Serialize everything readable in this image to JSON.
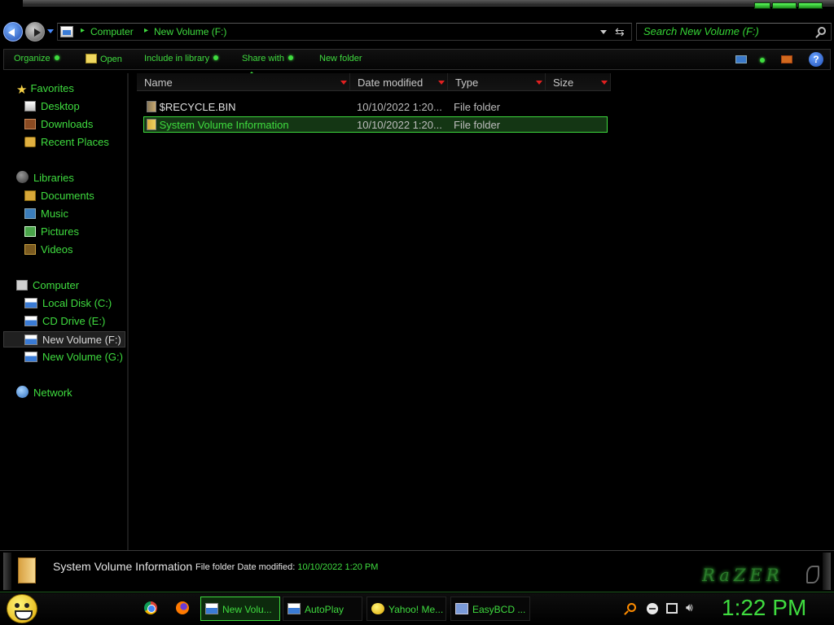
{
  "window": {
    "address": {
      "crumbs": [
        "Computer",
        "New Volume (F:)"
      ]
    },
    "search": {
      "placeholder": "Search New Volume (F:)"
    }
  },
  "toolbar": {
    "organize": "Organize",
    "open": "Open",
    "include_in_library": "Include in library",
    "share_with": "Share with",
    "new_folder": "New folder"
  },
  "nav": {
    "favorites": {
      "label": "Favorites",
      "items": [
        "Desktop",
        "Downloads",
        "Recent Places"
      ]
    },
    "libraries": {
      "label": "Libraries",
      "items": [
        "Documents",
        "Music",
        "Pictures",
        "Videos"
      ]
    },
    "computer": {
      "label": "Computer",
      "items": [
        "Local Disk (C:)",
        "CD Drive (E:)",
        "New Volume (F:)",
        "New Volume (G:)"
      ],
      "selected": "New Volume (F:)"
    },
    "network": {
      "label": "Network"
    }
  },
  "files": {
    "columns": [
      "Name",
      "Date modified",
      "Type",
      "Size"
    ],
    "rows": [
      {
        "name": "$RECYCLE.BIN",
        "date": "10/10/2022 1:20...",
        "type": "File folder",
        "size": ""
      },
      {
        "name": "System Volume Information",
        "date": "10/10/2022 1:20...",
        "type": "File folder",
        "size": "",
        "selected": true
      }
    ]
  },
  "details": {
    "name": "System Volume Information",
    "meta_prefix": "File folder  Date modified:",
    "date": "10/10/2022 1:20 PM",
    "brand": "RaZER"
  },
  "taskbar": {
    "pinned": [
      "chrome-icon",
      "firefox-icon"
    ],
    "tasks": [
      "New Volu...",
      "AutoPlay",
      "Yahoo! Me...",
      "EasyBCD ..."
    ],
    "active_task": "New Volu...",
    "clock": "1:22 PM"
  },
  "theme": {
    "accent": "#3fdc3f",
    "background": "#000000",
    "sort_arrow": "#e02020"
  }
}
